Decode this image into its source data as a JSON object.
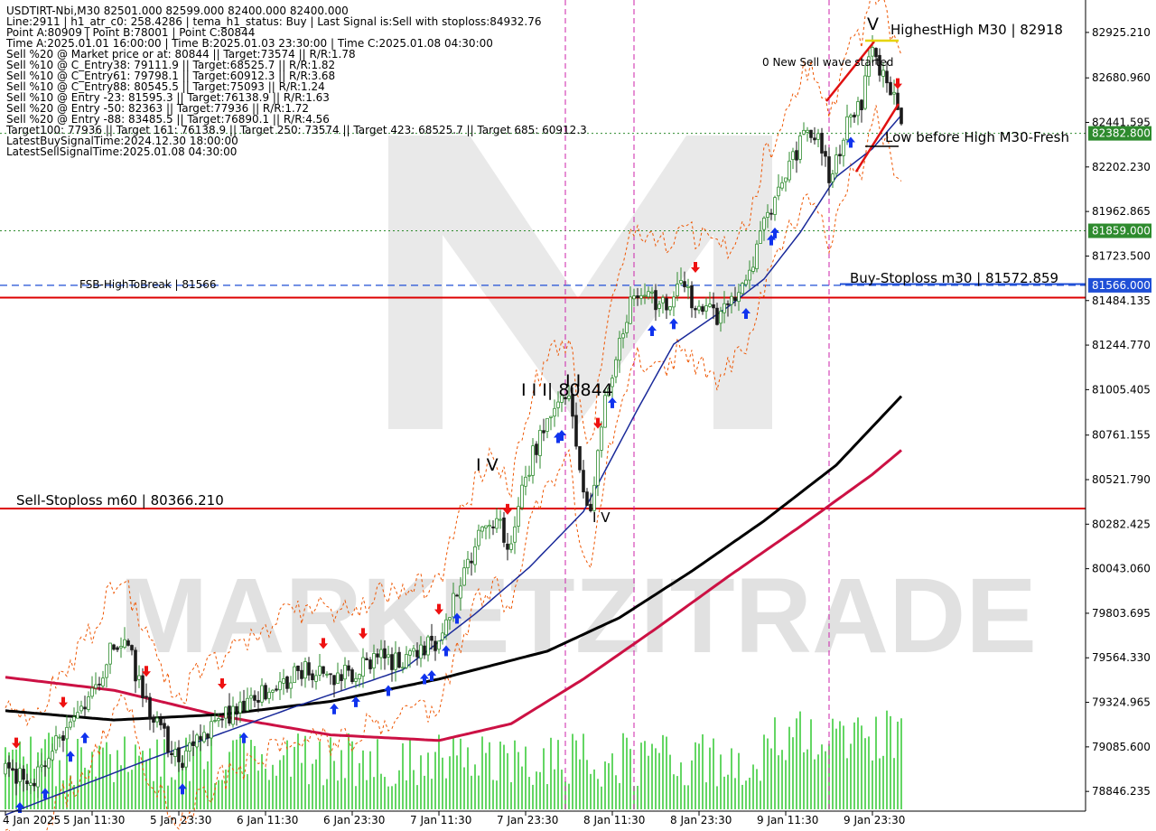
{
  "header_lines": [
    "USDTIRT-Nbi,M30  82501.000 82599.000 82400.000 82400.000",
    "Line:2911  | h1_atr_c0: 258.4286  | tema_h1_status: Buy  | Last Signal is:Sell with stoploss:84932.76",
    "Point A:80909 | Point B:78001 | Point C:80844",
    "Time A:2025.01.01 16:00:00 | Time B:2025.01.03 23:30:00 | Time C:2025.01.08 04:30:00",
    "Sell %20 @ Market price or at: 80844 || Target:73574 || R/R:1.78",
    "Sell %10 @ C_Entry38: 79111.9 || Target:68525.7 || R/R:1.82",
    "Sell %10 @ C_Entry61: 79798.1 || Target:60912.3 || R/R:3.68",
    "Sell %10 @ C_Entry88: 80545.5 || Target:75093 || R/R:1.24",
    "Sell %10 @ Entry -23: 81595.3 || Target:76138.9 || R/R:1.63",
    "Sell %20 @ Entry -50: 82363 || Target:77936 || R/R:1.72",
    "Sell %20 @ Entry -88: 83485.5 || Target:76890.1 || R/R:4.56",
    "Target100: 77936 || Target 161: 76138.9 || Target 250: 73574 || Target 423: 68525.7 || Target 685: 60912.3",
    "LatestBuySignalTime:2024.12.30 18:00:00",
    "LatestSellSignalTime:2025.01.08 04:30:00"
  ],
  "annotations": {
    "highest_high": "HighestHigh   M30 | 82918",
    "new_sell_wave": "0 New Sell wave started",
    "low_before_high": "Low before High   M30-Fresh",
    "buy_stoploss": "Buy-Stoploss m30 | 81572.859",
    "fsb_high": "FSB-HighToBreak | 81566",
    "sell_stoploss": "Sell-Stoploss m60 | 80366.210",
    "wave_iv": "I V",
    "wave_iii": "I I I| 80844",
    "wave_v": "V",
    "watermark": "MARKETZITRADE"
  },
  "price_badges": [
    {
      "label": "82382.800",
      "value": 82382.8,
      "color": "#2e8b2e"
    },
    {
      "label": "81859.000",
      "value": 81859.0,
      "color": "#2e8b2e"
    },
    {
      "label": "81566.000",
      "value": 81566.0,
      "color": "#1f4fd6"
    }
  ],
  "colors": {
    "up": "#2e8b2e",
    "down": "#1a1a1a",
    "ema_blue": "#1a2a9a",
    "ma_black": "#000000",
    "ma_red": "#cc1144",
    "envelope": "#ee5500",
    "volume": "#3dcc3d",
    "stoploss_red": "#dd0000",
    "fsb_blue": "#1f4fd6",
    "green_dotted": "#2e8b2e",
    "vline": "#cc22aa",
    "arrow_buy": "#1033ee",
    "arrow_sell": "#ee1111"
  },
  "chart_data": {
    "type": "candlestick",
    "symbol": "USDTIRT-Nbi",
    "timeframe": "M30",
    "ylim": [
      78750,
      83080
    ],
    "y_ticks": [
      {
        "label": "82925.210",
        "value": 82925.21
      },
      {
        "label": "82680.960",
        "value": 82680.96
      },
      {
        "label": "82441.595",
        "value": 82441.595
      },
      {
        "label": "82202.230",
        "value": 82202.23
      },
      {
        "label": "81962.865",
        "value": 81962.865
      },
      {
        "label": "81723.500",
        "value": 81723.5
      },
      {
        "label": "81484.135",
        "value": 81484.135
      },
      {
        "label": "81244.770",
        "value": 81244.77
      },
      {
        "label": "81005.405",
        "value": 81005.405
      },
      {
        "label": "80761.155",
        "value": 80761.155
      },
      {
        "label": "80521.790",
        "value": 80521.79
      },
      {
        "label": "80282.425",
        "value": 80282.425
      },
      {
        "label": "80043.060",
        "value": 80043.06
      },
      {
        "label": "79803.695",
        "value": 79803.695
      },
      {
        "label": "79564.330",
        "value": 79564.33
      },
      {
        "label": "79324.965",
        "value": 79324.965
      },
      {
        "label": "79085.600",
        "value": 79085.6
      },
      {
        "label": "78846.235",
        "value": 78846.235
      }
    ],
    "x_ticks": [
      {
        "label": "4 Jan 2025",
        "bar": 0
      },
      {
        "label": "5 Jan 11:30",
        "bar": 24
      },
      {
        "label": "5 Jan 23:30",
        "bar": 48
      },
      {
        "label": "6 Jan 11:30",
        "bar": 72
      },
      {
        "label": "6 Jan 23:30",
        "bar": 96
      },
      {
        "label": "7 Jan 11:30",
        "bar": 120
      },
      {
        "label": "7 Jan 23:30",
        "bar": 144
      },
      {
        "label": "8 Jan 11:30",
        "bar": 168
      },
      {
        "label": "8 Jan 23:30",
        "bar": 192
      },
      {
        "label": "9 Jan 11:30",
        "bar": 216
      },
      {
        "label": "9 Jan 23:30",
        "bar": 240
      }
    ],
    "close_path": [
      [
        0,
        78950
      ],
      [
        8,
        78900
      ],
      [
        14,
        79100
      ],
      [
        22,
        79300
      ],
      [
        26,
        79420
      ],
      [
        30,
        79650
      ],
      [
        34,
        79620
      ],
      [
        38,
        79350
      ],
      [
        44,
        79150
      ],
      [
        48,
        79000
      ],
      [
        54,
        79150
      ],
      [
        60,
        79250
      ],
      [
        66,
        79300
      ],
      [
        72,
        79380
      ],
      [
        78,
        79450
      ],
      [
        84,
        79500
      ],
      [
        90,
        79450
      ],
      [
        96,
        79480
      ],
      [
        102,
        79560
      ],
      [
        108,
        79550
      ],
      [
        114,
        79600
      ],
      [
        120,
        79650
      ],
      [
        126,
        80000
      ],
      [
        132,
        80250
      ],
      [
        136,
        80300
      ],
      [
        140,
        80150
      ],
      [
        144,
        80550
      ],
      [
        148,
        80750
      ],
      [
        152,
        80900
      ],
      [
        156,
        80950
      ],
      [
        158,
        80700
      ],
      [
        160,
        80450
      ],
      [
        162,
        80350
      ],
      [
        166,
        80950
      ],
      [
        170,
        81250
      ],
      [
        174,
        81550
      ],
      [
        178,
        81500
      ],
      [
        182,
        81450
      ],
      [
        186,
        81550
      ],
      [
        190,
        81500
      ],
      [
        194,
        81450
      ],
      [
        198,
        81380
      ],
      [
        202,
        81520
      ],
      [
        206,
        81600
      ],
      [
        210,
        81900
      ],
      [
        214,
        82050
      ],
      [
        218,
        82250
      ],
      [
        222,
        82400
      ],
      [
        225,
        82350
      ],
      [
        228,
        82150
      ],
      [
        231,
        82300
      ],
      [
        234,
        82500
      ],
      [
        237,
        82550
      ],
      [
        240,
        82850
      ],
      [
        243,
        82700
      ],
      [
        246,
        82550
      ],
      [
        248,
        82400
      ]
    ],
    "ema_blue_path": [
      [
        0,
        78720
      ],
      [
        40,
        79020
      ],
      [
        80,
        79300
      ],
      [
        110,
        79500
      ],
      [
        130,
        79800
      ],
      [
        145,
        80050
      ],
      [
        160,
        80350
      ],
      [
        175,
        80900
      ],
      [
        185,
        81250
      ],
      [
        200,
        81450
      ],
      [
        210,
        81600
      ],
      [
        220,
        81850
      ],
      [
        230,
        82150
      ],
      [
        240,
        82300
      ],
      [
        248,
        82480
      ]
    ],
    "ma_black_path": [
      [
        0,
        79280
      ],
      [
        30,
        79230
      ],
      [
        60,
        79260
      ],
      [
        90,
        79330
      ],
      [
        120,
        79450
      ],
      [
        150,
        79600
      ],
      [
        170,
        79780
      ],
      [
        190,
        80030
      ],
      [
        210,
        80300
      ],
      [
        230,
        80600
      ],
      [
        248,
        80970
      ]
    ],
    "ma_red_path": [
      [
        0,
        79460
      ],
      [
        30,
        79390
      ],
      [
        60,
        79250
      ],
      [
        90,
        79150
      ],
      [
        120,
        79120
      ],
      [
        140,
        79210
      ],
      [
        160,
        79450
      ],
      [
        180,
        79720
      ],
      [
        200,
        80000
      ],
      [
        220,
        80270
      ],
      [
        240,
        80550
      ],
      [
        248,
        80680
      ]
    ],
    "levels": [
      {
        "name": "Sell-Stoploss m60",
        "value": 80366.21
      },
      {
        "name": "FSB-HighToBreak",
        "value": 81566
      },
      {
        "name": "Buy-Stoploss m30",
        "value": 81572.859
      },
      {
        "name": "red-line-upper",
        "value": 81500
      },
      {
        "name": "green-dotted-upper",
        "value": 82382.8
      },
      {
        "name": "green-dotted-lower",
        "value": 81859
      }
    ],
    "vertical_markers": [
      155,
      174,
      228
    ],
    "buy_arrows": [
      4,
      11,
      18,
      22,
      49,
      66,
      91,
      97,
      106,
      116,
      118,
      122,
      125,
      153,
      154,
      168,
      179,
      185,
      205,
      212,
      213,
      234
    ],
    "sell_arrows": [
      3,
      16,
      39,
      60,
      88,
      99,
      120,
      139,
      164,
      191,
      247
    ]
  }
}
